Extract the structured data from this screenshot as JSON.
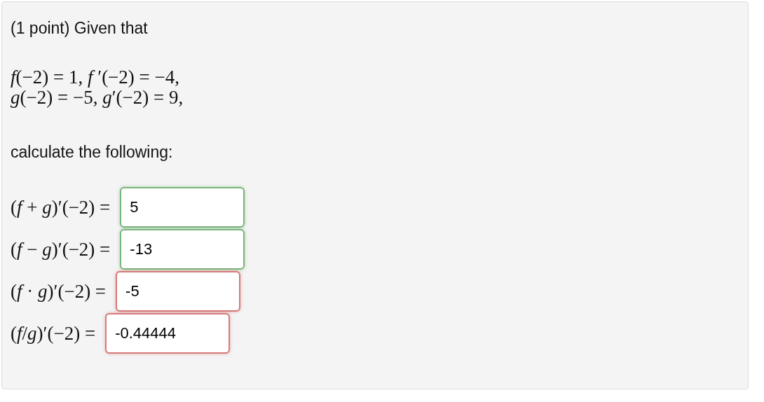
{
  "intro": "(1 point) Given that",
  "given": [
    "*f*(−2) = 1, *f* ′(−2) = −4,",
    "*g*(−2) = −5, *g*′(−2) = 9,"
  ],
  "prompt": "calculate the following:",
  "answers": [
    {
      "label": "(*f* + *g*)′(−2) =",
      "value": "5",
      "correct": true
    },
    {
      "label": "(*f* − *g*)′(−2) =",
      "value": "-13",
      "correct": true
    },
    {
      "label": "(*f* · *g*)′(−2) =",
      "value": "-5",
      "correct": false
    },
    {
      "label": "(*f*/*g*)′(−2) =",
      "value": "-0.44444",
      "correct": false
    }
  ]
}
